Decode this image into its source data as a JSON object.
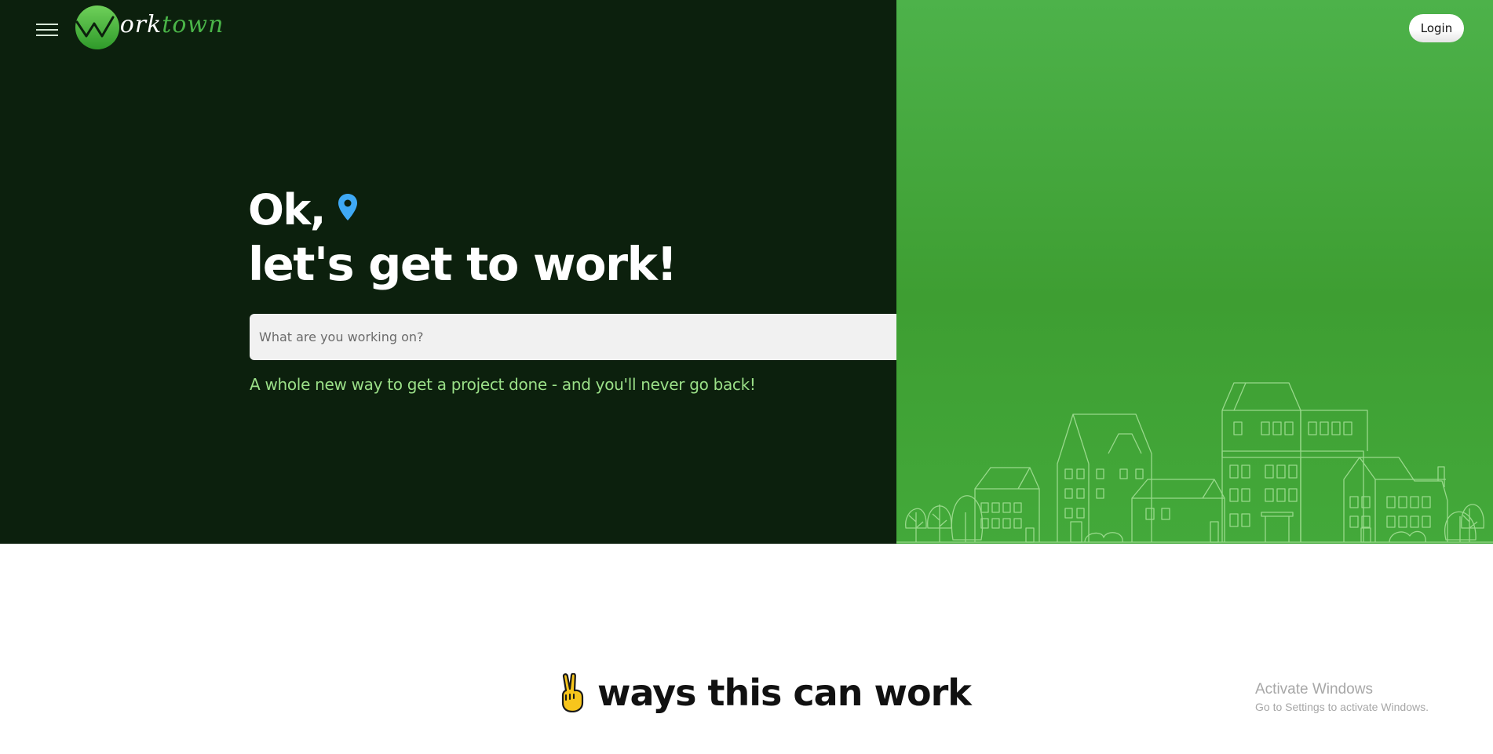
{
  "header": {
    "menu_icon": "hamburger-menu-icon",
    "logo": {
      "letter_w": "w",
      "part1": "ork",
      "part2": "town"
    },
    "login_label": "Login"
  },
  "hero": {
    "headline_line1": "Ok,",
    "location_icon": "map-pin-icon",
    "headline_line2": "let's get to work!",
    "search": {
      "placeholder": "What are you working on?",
      "value": ""
    },
    "tagline": "A whole new way to get a project done - and you'll never go back!",
    "illustration": "town-buildings-illustration"
  },
  "section": {
    "icon": "victory-hand-icon",
    "title": "ways this can work"
  },
  "watermark": {
    "line1": "Activate Windows",
    "line2": "Go to Settings to activate Windows."
  },
  "colors": {
    "dark_green": "#0c200d",
    "bright_green": "#4db24a",
    "accent_green_text": "#9be088",
    "pin_blue": "#3fa9f5"
  }
}
